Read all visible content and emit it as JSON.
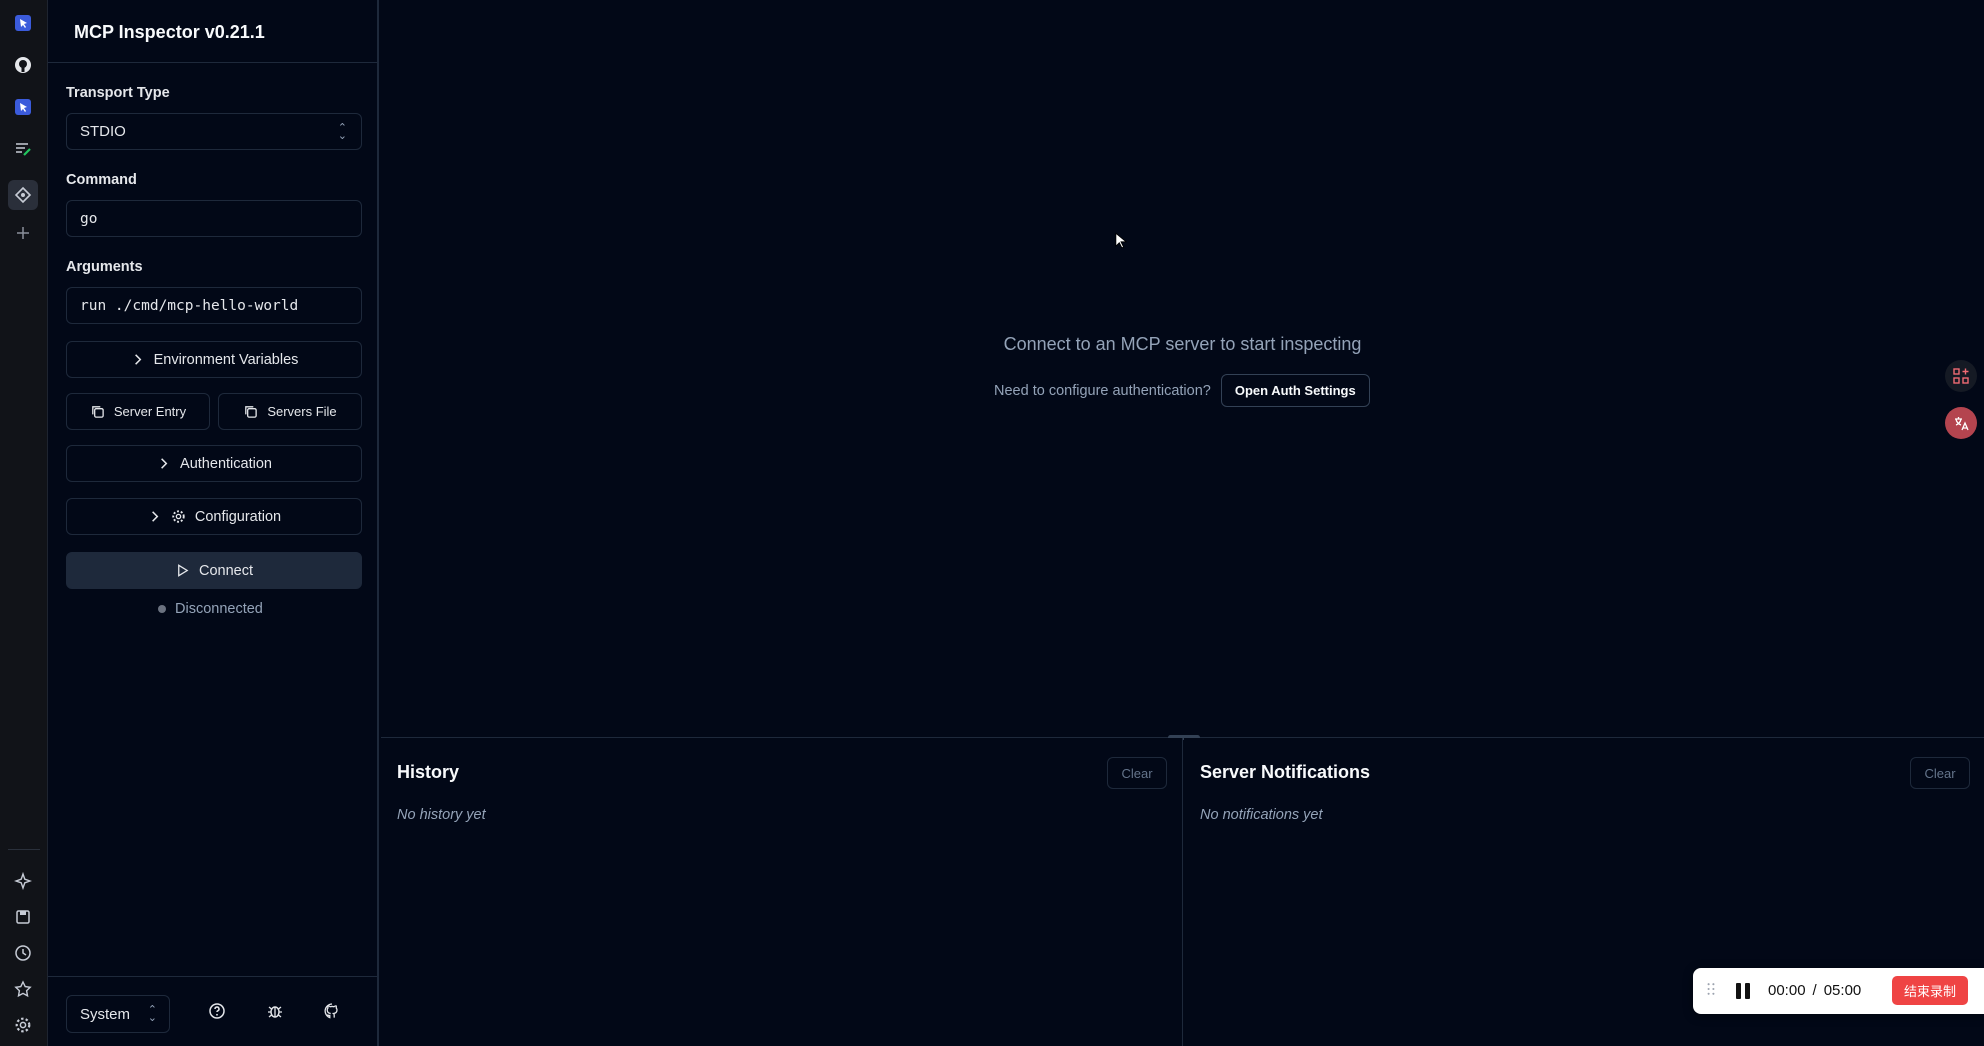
{
  "app": {
    "title": "MCP Inspector v0.21.1"
  },
  "rail": {
    "icons": [
      "cursor-app-icon",
      "github-icon",
      "cursor-app-icon",
      "notes-icon",
      "extension-icon",
      "plus-icon",
      "sparkle-icon",
      "save-icon",
      "history-icon",
      "star-icon",
      "gear-icon"
    ]
  },
  "sidebar": {
    "transport_label": "Transport Type",
    "transport_value": "STDIO",
    "command_label": "Command",
    "command_value": "go",
    "arguments_label": "Arguments",
    "arguments_value": "run ./cmd/mcp-hello-world",
    "env_vars_label": "Environment Variables",
    "server_entry_label": "Server Entry",
    "servers_file_label": "Servers File",
    "authentication_label": "Authentication",
    "configuration_label": "Configuration",
    "connect_label": "Connect",
    "status_text": "Disconnected",
    "status_color": "#6b7280",
    "theme_value": "System"
  },
  "main": {
    "empty_message": "Connect to an MCP server to start inspecting",
    "auth_prompt": "Need to configure authentication?",
    "auth_button": "Open Auth Settings"
  },
  "history": {
    "title": "History",
    "clear_label": "Clear",
    "empty_text": "No history yet"
  },
  "notifications": {
    "title": "Server Notifications",
    "clear_label": "Clear",
    "empty_text": "No notifications yet"
  },
  "recorder": {
    "elapsed": "00:00",
    "separator": "/",
    "limit": "05:00",
    "stop_label": "结束录制",
    "stop_color": "#ef4444"
  }
}
